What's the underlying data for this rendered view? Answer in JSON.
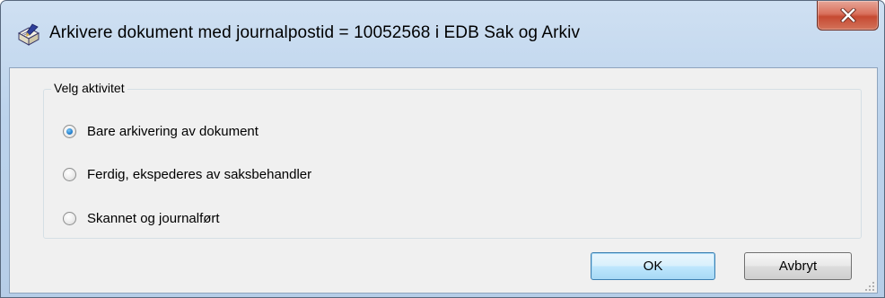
{
  "window": {
    "title": "Arkivere dokument med journalpostid = 10052568 i EDB Sak og Arkiv",
    "icon": "document-pen-icon",
    "close_icon": "close-icon"
  },
  "group": {
    "legend": "Velg aktivitet",
    "options": [
      {
        "label": "Bare arkivering av dokument",
        "selected": true
      },
      {
        "label": "Ferdig, ekspederes av saksbehandler",
        "selected": false
      },
      {
        "label": "Skannet og journalført",
        "selected": false
      }
    ]
  },
  "buttons": {
    "ok_label": "OK",
    "cancel_label": "Avbryt"
  },
  "colors": {
    "title_gradient_top": "#cfe0f2",
    "close_red": "#c64a32",
    "client_bg": "#f0f0f0",
    "radio_selected_blue": "#2a86d3"
  }
}
